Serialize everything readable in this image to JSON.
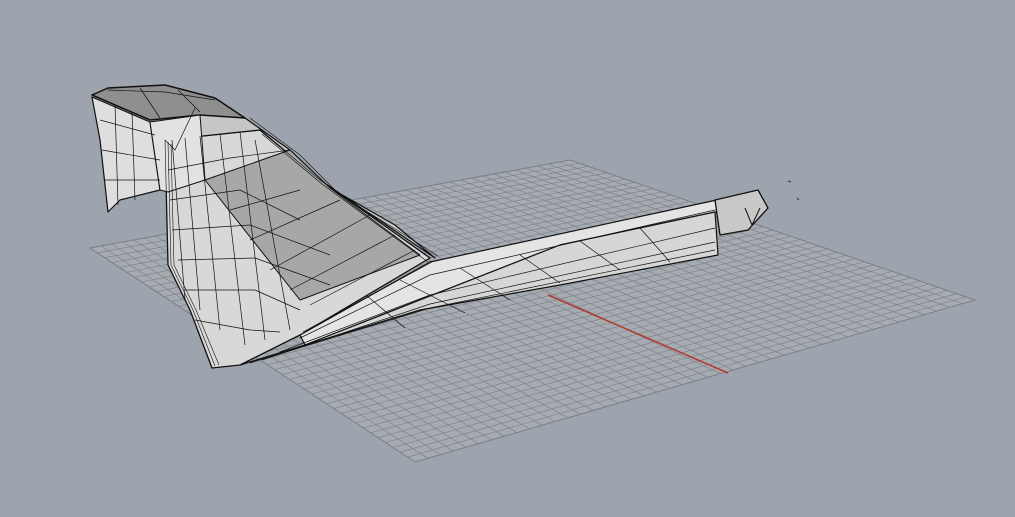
{
  "viewport": {
    "background_color": "#9ea4ad",
    "grid_color": "#7a7f87",
    "grid_fill": "#a6abb2",
    "x_axis_color": "#b23a2e",
    "model_fill_light": "#dcdcdc",
    "model_fill_mid": "#bcbcbc",
    "model_fill_dark": "#8f8f8f",
    "wire_color": "#111111"
  }
}
